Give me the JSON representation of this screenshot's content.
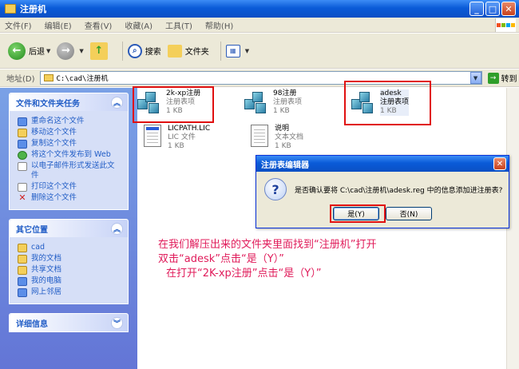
{
  "window": {
    "title": "注册机"
  },
  "menu": [
    "文件(F)",
    "编辑(E)",
    "查看(V)",
    "收藏(A)",
    "工具(T)",
    "帮助(H)"
  ],
  "toolbar": {
    "back": "后退",
    "search": "搜索",
    "folders": "文件夹"
  },
  "address": {
    "label": "地址(D)",
    "value": "C:\\cad\\注册机",
    "go": "转到"
  },
  "left": {
    "tasks_title": "文件和文件夹任务",
    "tasks": [
      {
        "label": "重命名这个文件"
      },
      {
        "label": "移动这个文件"
      },
      {
        "label": "复制这个文件"
      },
      {
        "label": "将这个文件发布到 Web"
      },
      {
        "label": "以电子邮件形式发送此文件"
      },
      {
        "label": "打印这个文件"
      },
      {
        "label": "删除这个文件"
      }
    ],
    "places_title": "其它位置",
    "places": [
      {
        "label": "cad"
      },
      {
        "label": "我的文档"
      },
      {
        "label": "共享文档"
      },
      {
        "label": "我的电脑"
      },
      {
        "label": "网上邻居"
      }
    ],
    "details_title": "详细信息"
  },
  "files": [
    {
      "name": "2k-xp注册",
      "type": "注册表项",
      "size": "1 KB"
    },
    {
      "name": "98注册",
      "type": "注册表项",
      "size": "1 KB"
    },
    {
      "name": "adesk",
      "type": "注册表项",
      "size": "1 KB"
    },
    {
      "name": "LICPATH.LIC",
      "type": "LIC 文件",
      "size": "1 KB"
    },
    {
      "name": "说明",
      "type": "文本文档",
      "size": "1 KB"
    }
  ],
  "dialog": {
    "title": "注册表编辑器",
    "message": "是否确认要将 C:\\cad\\注册机\\adesk.reg 中的信息添加进注册表?",
    "yes": "是(Y)",
    "no": "否(N)"
  },
  "annotation": [
    "在我们解压出来的文件夹里面找到“注册机”打开",
    "双击“adesk”点击“是（Y）”",
    "在打开“2K-xp注册”点击“是（Y）”"
  ],
  "colors": {
    "xp_blue": "#0a5bd8",
    "task_pane": "#6375d6",
    "link": "#215dc6",
    "highlight_red": "#e01010",
    "annotation": "#e01b5a"
  }
}
